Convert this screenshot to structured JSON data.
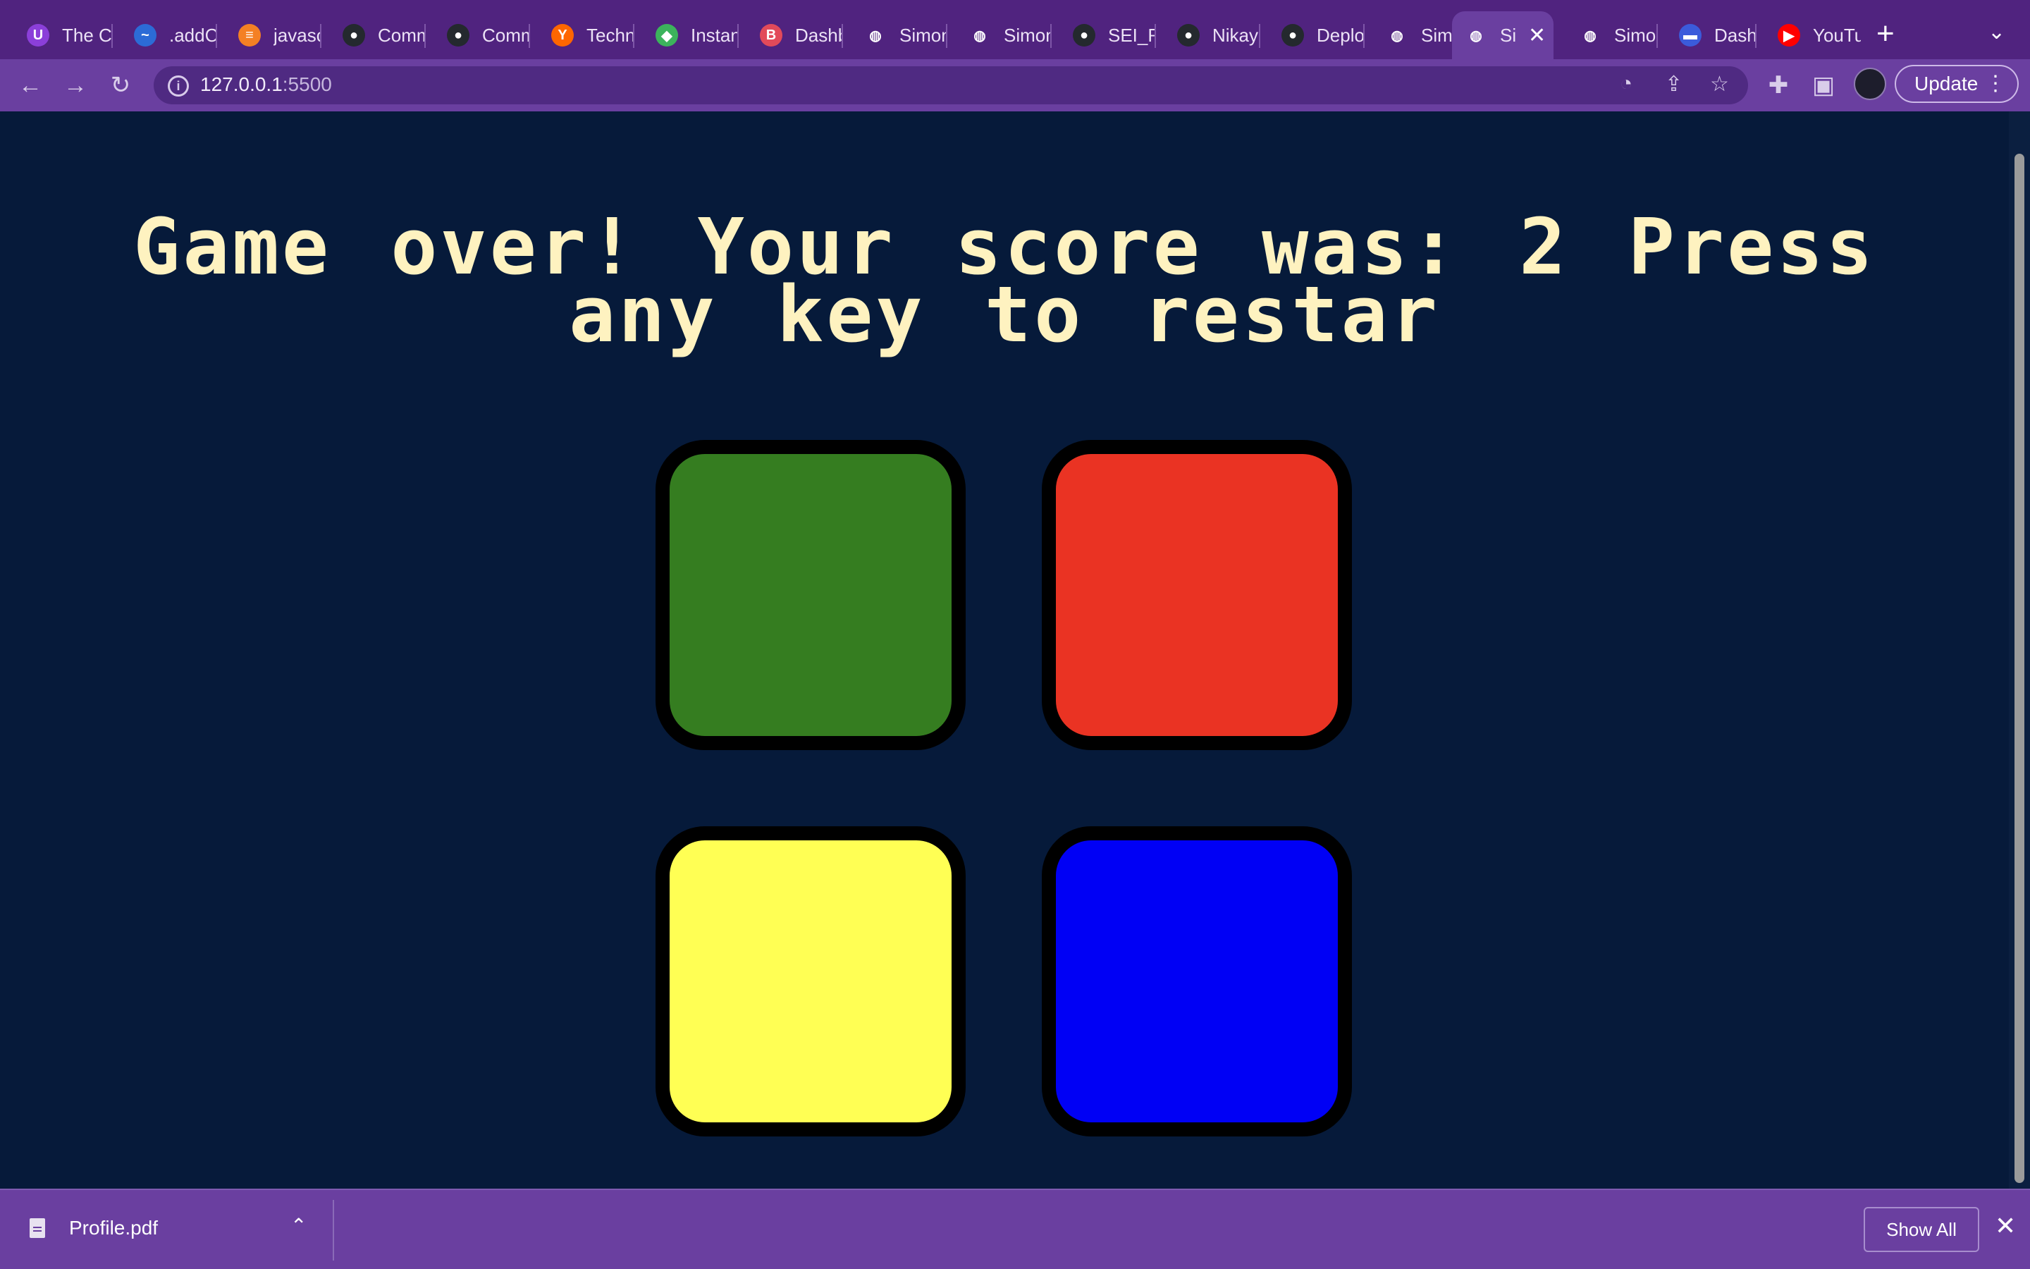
{
  "browser": {
    "tabs": [
      {
        "label": "The C",
        "favicon": "purple-shield-icon",
        "color": "#8b3fd9",
        "glyph": "U"
      },
      {
        "label": ".addC",
        "favicon": "wave-icon",
        "color": "#2c6bd6",
        "glyph": "~"
      },
      {
        "label": "javasc",
        "favicon": "stackoverflow-icon",
        "color": "#f48024",
        "glyph": "≡"
      },
      {
        "label": "Comm",
        "favicon": "github-icon",
        "color": "#24292e",
        "glyph": "●"
      },
      {
        "label": "Comm",
        "favicon": "github-icon",
        "color": "#24292e",
        "glyph": "●"
      },
      {
        "label": "Techn",
        "favicon": "ycombinator-icon",
        "color": "#ff6600",
        "glyph": "Y"
      },
      {
        "label": "Instan",
        "favicon": "leaf-icon",
        "color": "#3cb35c",
        "glyph": "◆"
      },
      {
        "label": "Dashb",
        "favicon": "bold-b-icon",
        "color": "#e24a5a",
        "glyph": "B"
      },
      {
        "label": "Simon",
        "favicon": "globe-icon",
        "color": "#ffffff",
        "glyph": "◍"
      },
      {
        "label": "Simon",
        "favicon": "globe-icon",
        "color": "#ffffff",
        "glyph": "◍"
      },
      {
        "label": "SEI_R",
        "favicon": "github-icon",
        "color": "#24292e",
        "glyph": "●"
      },
      {
        "label": "Nikay",
        "favicon": "github-icon",
        "color": "#24292e",
        "glyph": "●"
      },
      {
        "label": "Deplo",
        "favicon": "github-icon",
        "color": "#24292e",
        "glyph": "●"
      },
      {
        "label": "Simon",
        "favicon": "globe-icon",
        "color": "#ffffff",
        "glyph": "◍"
      },
      {
        "label": "Si",
        "favicon": "globe-icon",
        "color": "#ffffff",
        "glyph": "◍",
        "active": true
      },
      {
        "label": "Simon",
        "favicon": "globe-icon",
        "color": "#ffffff",
        "glyph": "◍"
      },
      {
        "label": "Dashb",
        "favicon": "dashboard-icon",
        "color": "#3b5bdb",
        "glyph": "▬"
      },
      {
        "label": "YouTu",
        "favicon": "youtube-icon",
        "color": "#ff0000",
        "glyph": "▶"
      }
    ],
    "url_host": "127.0.0.1",
    "url_port": ":5500",
    "update_label": "Update"
  },
  "game": {
    "title": "Game over! Your score was: 2 Press any key to restar",
    "pads": [
      {
        "name": "green",
        "color": "#357d20"
      },
      {
        "name": "red",
        "color": "#ea3323"
      },
      {
        "name": "yellow",
        "color": "#ffff54"
      },
      {
        "name": "blue",
        "color": "#0000f5"
      }
    ]
  },
  "downloads": {
    "file_name": "Profile.pdf",
    "show_all_label": "Show All"
  }
}
